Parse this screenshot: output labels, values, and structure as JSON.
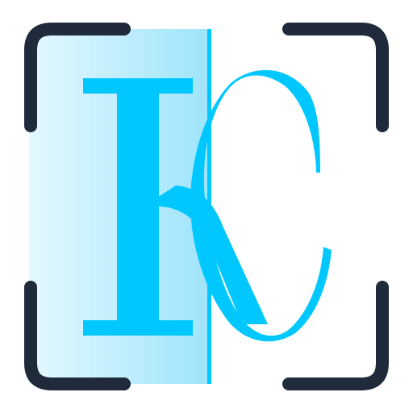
{
  "logo": {
    "letter_left": "I",
    "letter_right": "C"
  },
  "colors": {
    "frame": "#1f2a3a",
    "accent": "#00c8ff",
    "panel_light": "#e4f8ff",
    "panel_dark": "#9fe4fb",
    "background": "#ffffff"
  },
  "icons": [
    "scan-frame-icon",
    "logo-mark-icon"
  ]
}
